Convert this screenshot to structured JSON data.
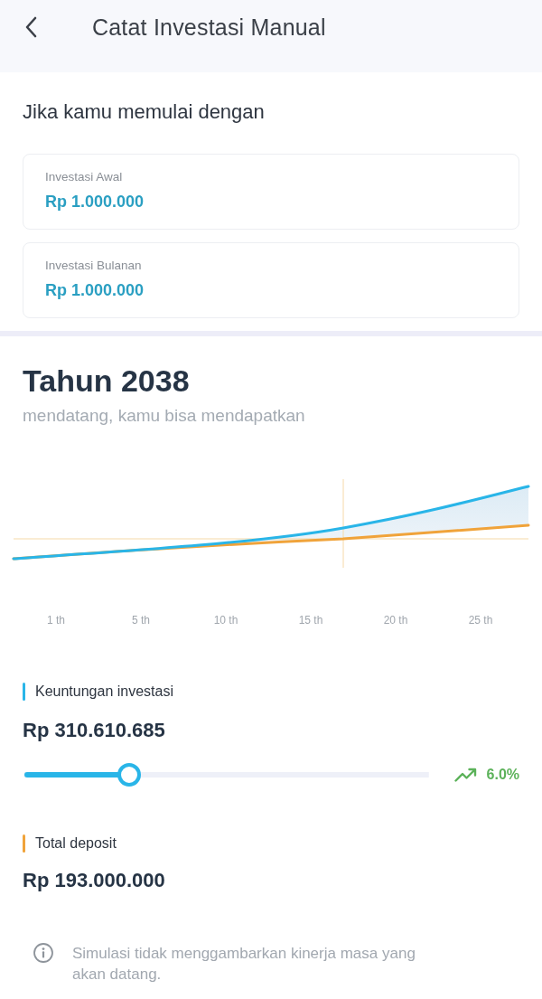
{
  "header": {
    "title": "Catat Investasi Manual"
  },
  "intro": "Jika kamu memulai dengan",
  "inputs": [
    {
      "label": "Investasi Awal",
      "value": "Rp 1.000.000"
    },
    {
      "label": "Investasi Bulanan",
      "value": "Rp 1.000.000"
    }
  ],
  "projection": {
    "title": "Tahun 2038",
    "subtitle": "mendatang, kamu bisa mendapatkan"
  },
  "chart": {
    "x_labels": [
      "1 th",
      "5 th",
      "10 th",
      "15 th",
      "20 th",
      "25 th"
    ]
  },
  "results": [
    {
      "kind": "profit",
      "label": "Keuntungan investasi",
      "color": "#29b5e8",
      "value": "Rp 310.610.685",
      "slider": {
        "level": 0.26,
        "reading": "6.0%"
      }
    },
    {
      "kind": "deposit",
      "label": "Total deposit",
      "color": "#f0a33a",
      "value": "Rp 193.000.000"
    }
  ],
  "note": "Simulasi tidak menggambarkan kinerja masa yang akan datang."
}
